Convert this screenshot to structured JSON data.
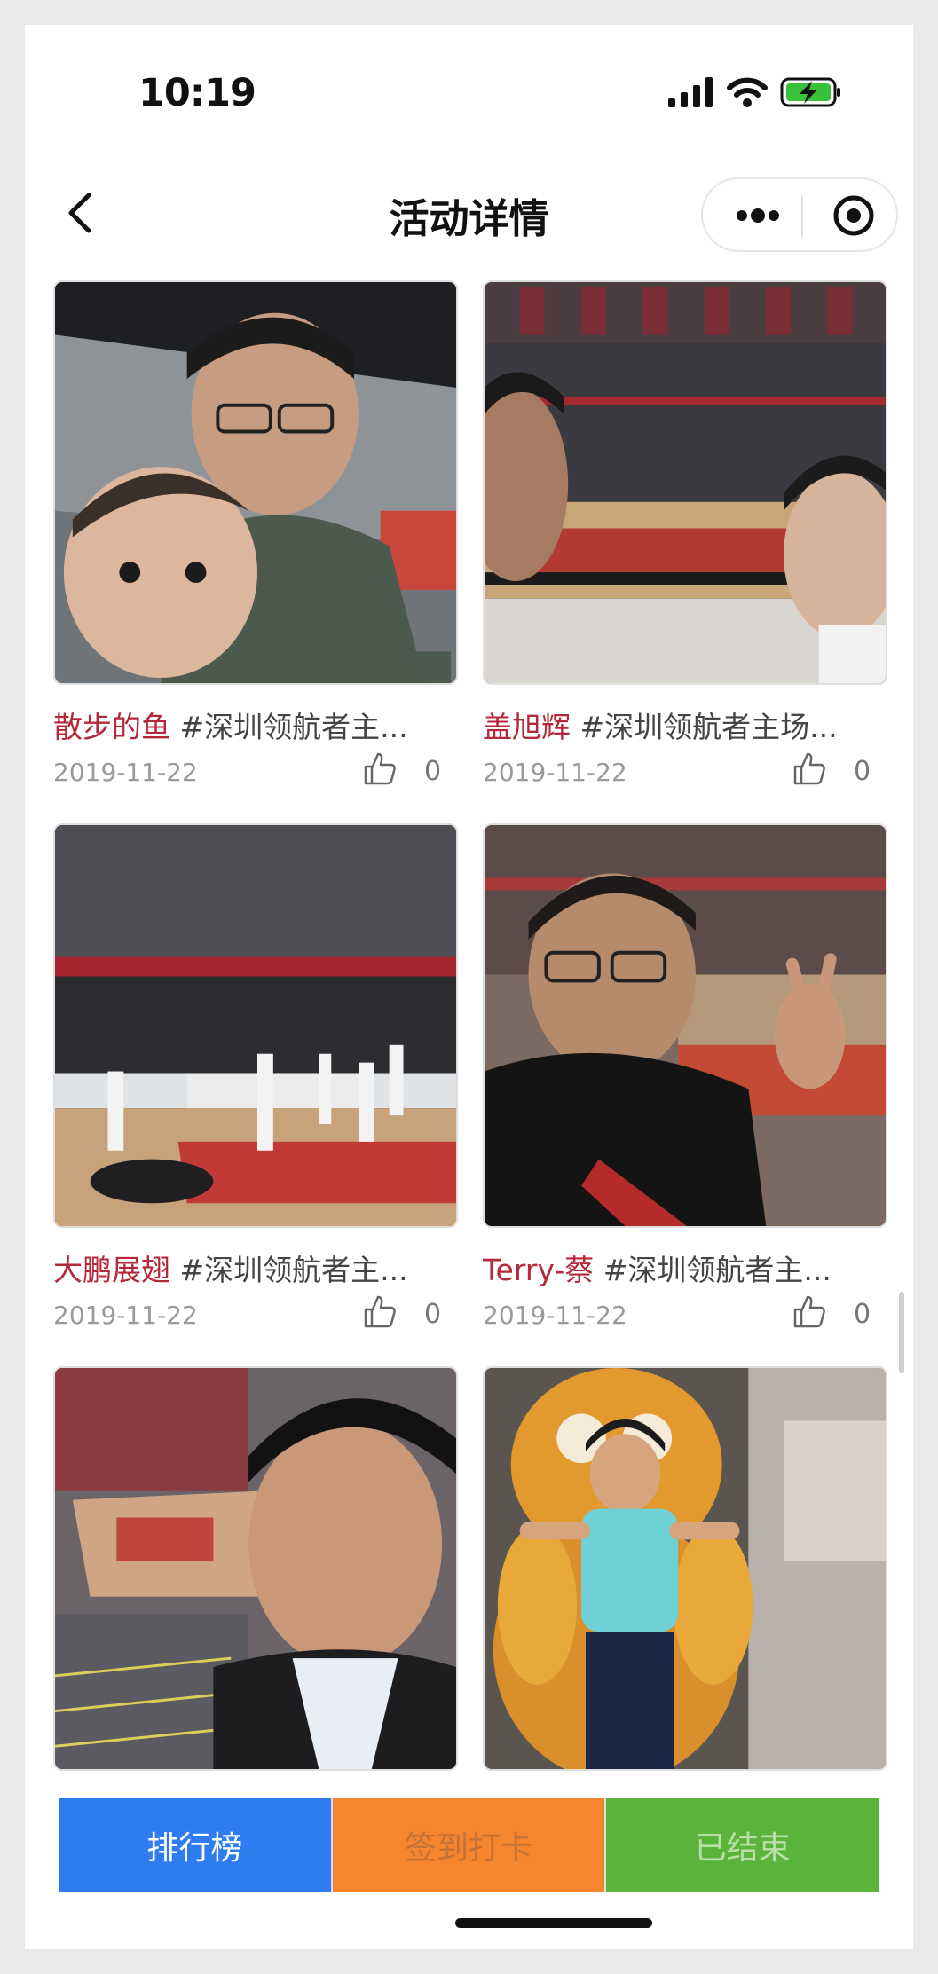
{
  "status_bar": {
    "time": "10:19",
    "icons": [
      "signal-icon",
      "wifi-icon",
      "battery-charging-icon"
    ]
  },
  "nav": {
    "title": "活动详情",
    "back_icon": "chevron-left-icon",
    "more_icon": "more-dots-icon",
    "target_icon": "target-icon"
  },
  "posts": [
    {
      "author": "散步的鱼",
      "text": " #深圳领航者主...",
      "date": "2019-11-22",
      "likes": "0",
      "photo_theme": "stadium-selfie-father-baby"
    },
    {
      "author": "盖旭辉",
      "text": " #深圳领航者主场...",
      "date": "2019-11-22",
      "likes": "0",
      "photo_theme": "arena-court-selfie"
    },
    {
      "author": "大鹏展翅",
      "text": " #深圳领航者主...",
      "date": "2019-11-22",
      "likes": "0",
      "photo_theme": "arena-warmup"
    },
    {
      "author": "Terry-蔡",
      "text": " #深圳领航者主...",
      "date": "2019-11-22",
      "likes": "0",
      "photo_theme": "man-peace-sign"
    },
    {
      "author": "",
      "text": "",
      "date": "",
      "likes": "",
      "photo_theme": "arena-man-selfie"
    },
    {
      "author": "",
      "text": "",
      "date": "",
      "likes": "",
      "photo_theme": "boy-with-cat-statue"
    }
  ],
  "bottom_bar": {
    "rank_label": "排行榜",
    "checkin_label": "签到打卡",
    "status_label": "已结束"
  },
  "colors": {
    "author": "#b5283a",
    "rank_button": "#2f7cf0",
    "checkin_button": "#f5852f",
    "ended_button": "#5ab33a"
  }
}
